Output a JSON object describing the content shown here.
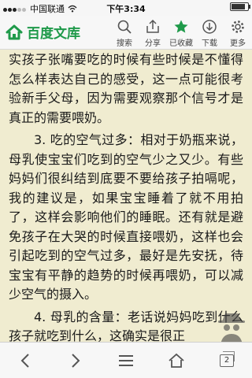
{
  "status_bar": {
    "carrier": "中国联通",
    "time": "下午3:34",
    "signal_bars": 3,
    "signal_total": 5,
    "battery_level": 0.85
  },
  "toolbar": {
    "app_title": "百度文库",
    "actions": [
      {
        "label": "搜索",
        "icon": "search-icon"
      },
      {
        "label": "分享",
        "icon": "share-icon"
      },
      {
        "label": "已收藏",
        "icon": "star-icon"
      },
      {
        "label": "下载",
        "icon": "download-icon"
      },
      {
        "label": "更多",
        "icon": "gear-icon"
      }
    ]
  },
  "article": {
    "paragraphs": [
      "实孩子张嘴要吃的时候有些时候是不懂得怎么样表达自己的感受，这一点可能很考验新手父母，因为需要观察那个信号才是真正的需要喂奶。",
      "3. 吃的空气过多：相对于奶瓶来说，母乳使宝宝们吃到的空气少之又少。有些妈妈们很纠结到底要不要给孩子拍嗝呢，我的建议是，如果宝宝睡着了就不用拍了，这样会影响他们的睡眠。还有就是避免孩子在大哭的时候直接喂奶，这样也会引起吃到的空气过多，最好是先安抚，待宝宝有平静的趋势的时候再喂奶，可以减少空气的摄入。",
      "4. 母乳的含量：老话说妈妈吃到什么孩子就吃到什么，这确实是很正"
    ]
  },
  "bottom_nav": {
    "tab_count": "2",
    "buttons": [
      "back-icon",
      "forward-icon",
      "menu-icon",
      "home-icon",
      "tabs-icon"
    ]
  },
  "colors": {
    "brand_green": "#1f9a4a",
    "reading_background": "#f0ecd0"
  }
}
